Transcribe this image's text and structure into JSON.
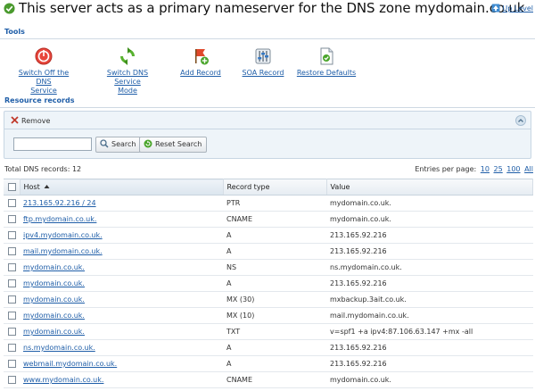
{
  "header": {
    "title": "This server acts as a primary nameserver for the DNS zone mydomain.co.uk",
    "up_level": "Up Level"
  },
  "tools": {
    "section_title": "Tools",
    "items": [
      {
        "line1": "Switch Off the DNS",
        "line2": "Service",
        "icon": "power-off-icon"
      },
      {
        "line1": "Switch DNS Service",
        "line2": "Mode",
        "icon": "refresh-icon"
      },
      {
        "line1": "Add Record",
        "line2": "",
        "icon": "add-flag-icon"
      },
      {
        "line1": "SOA Record",
        "line2": "",
        "icon": "soa-settings-icon"
      },
      {
        "line1": "Restore Defaults",
        "line2": "",
        "icon": "restore-document-icon"
      }
    ]
  },
  "records": {
    "section_title": "Resource records",
    "remove_label": "Remove",
    "search_value": "",
    "search_button": "Search",
    "reset_button": "Reset Search",
    "total_label": "Total DNS records: 12",
    "per_page_label": "Entries per page:",
    "per_page_options": [
      "10",
      "25",
      "100",
      "All"
    ],
    "columns": {
      "host": "Host",
      "type": "Record type",
      "value": "Value"
    },
    "rows": [
      {
        "host": "213.165.92.216 / 24",
        "type": "PTR",
        "value": "mydomain.co.uk."
      },
      {
        "host": "ftp.mydomain.co.uk.",
        "type": "CNAME",
        "value": "mydomain.co.uk."
      },
      {
        "host": "ipv4.mydomain.co.uk.",
        "type": "A",
        "value": "213.165.92.216"
      },
      {
        "host": "mail.mydomain.co.uk.",
        "type": "A",
        "value": "213.165.92.216"
      },
      {
        "host": "mydomain.co.uk.",
        "type": "NS",
        "value": "ns.mydomain.co.uk."
      },
      {
        "host": "mydomain.co.uk.",
        "type": "A",
        "value": "213.165.92.216"
      },
      {
        "host": "mydomain.co.uk.",
        "type": "MX (30)",
        "value": "mxbackup.3ait.co.uk."
      },
      {
        "host": "mydomain.co.uk.",
        "type": "MX (10)",
        "value": "mail.mydomain.co.uk."
      },
      {
        "host": "mydomain.co.uk.",
        "type": "TXT",
        "value": "v=spf1 +a ipv4:87.106.63.147 +mx -all"
      },
      {
        "host": "ns.mydomain.co.uk.",
        "type": "A",
        "value": "213.165.92.216"
      },
      {
        "host": "webmail.mydomain.co.uk.",
        "type": "A",
        "value": "213.165.92.216"
      },
      {
        "host": "www.mydomain.co.uk.",
        "type": "CNAME",
        "value": "mydomain.co.uk."
      }
    ]
  }
}
